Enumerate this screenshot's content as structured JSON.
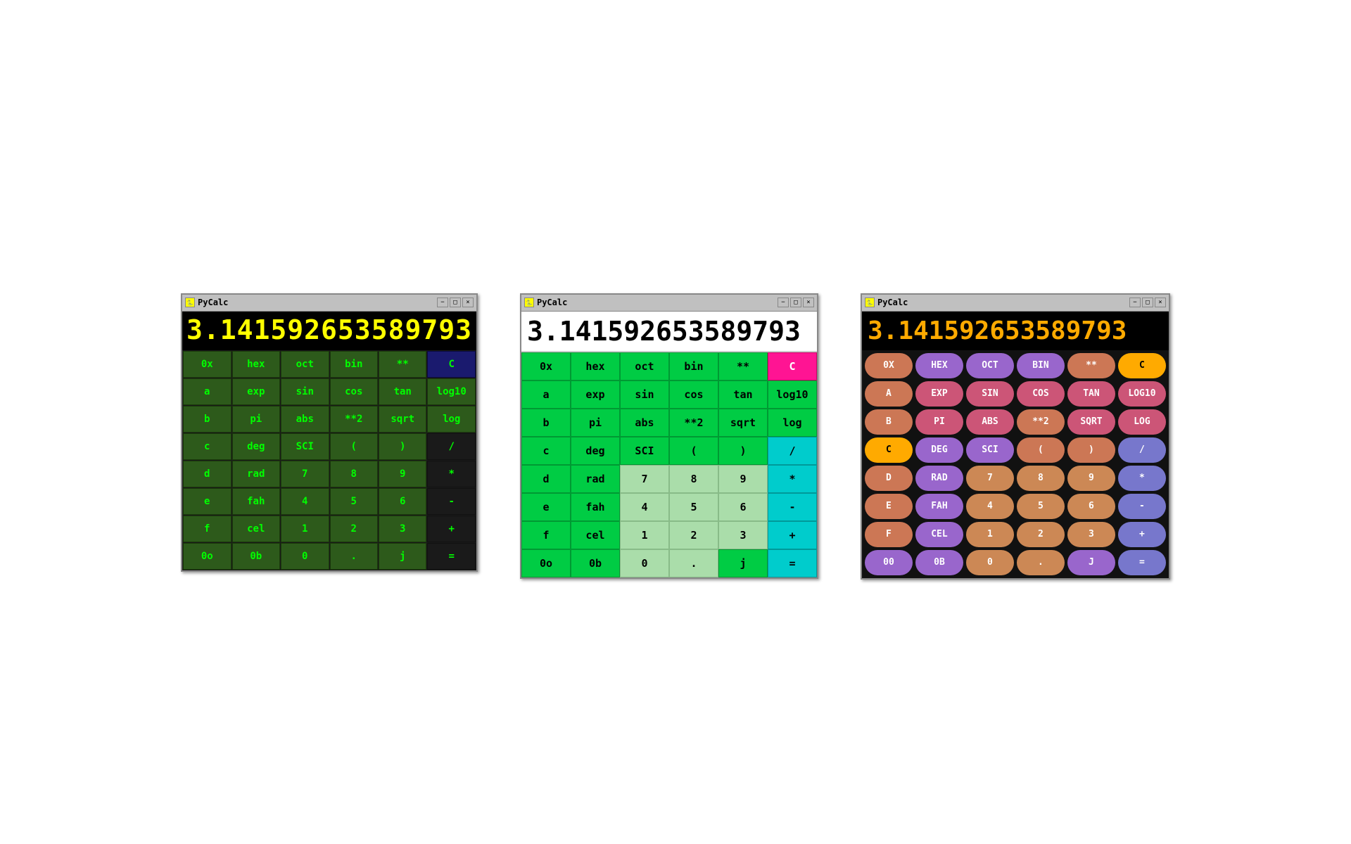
{
  "display_value": "3.141592653589793",
  "title": "PyCalc",
  "title_icon": "🐍",
  "window_controls": [
    "−",
    "□",
    "×"
  ],
  "calc1": {
    "rows": [
      [
        "0x",
        "hex",
        "oct",
        "bin",
        "**",
        "C"
      ],
      [
        "a",
        "exp",
        "sin",
        "cos",
        "tan",
        "log10"
      ],
      [
        "b",
        "pi",
        "abs",
        "**2",
        "sqrt",
        "log"
      ],
      [
        "c",
        "deg",
        "SCI",
        "(",
        ")",
        "/"
      ],
      [
        "d",
        "rad",
        "7",
        "8",
        "9",
        "*"
      ],
      [
        "e",
        "fah",
        "4",
        "5",
        "6",
        "-"
      ],
      [
        "f",
        "cel",
        "1",
        "2",
        "3",
        "+"
      ],
      [
        "0o",
        "0b",
        "0",
        ".",
        "j",
        "="
      ]
    ]
  },
  "calc2": {
    "rows": [
      [
        "0x",
        "hex",
        "oct",
        "bin",
        "**",
        "C"
      ],
      [
        "a",
        "exp",
        "sin",
        "cos",
        "tan",
        "log10"
      ],
      [
        "b",
        "pi",
        "abs",
        "**2",
        "sqrt",
        "log"
      ],
      [
        "c",
        "deg",
        "SCI",
        "(",
        ")",
        "/"
      ],
      [
        "d",
        "rad",
        "7",
        "8",
        "9",
        "*"
      ],
      [
        "e",
        "fah",
        "4",
        "5",
        "6",
        "-"
      ],
      [
        "f",
        "cel",
        "1",
        "2",
        "3",
        "+"
      ],
      [
        "0o",
        "0b",
        "0",
        ".",
        "j",
        "="
      ]
    ]
  },
  "calc3": {
    "rows": [
      [
        "0X",
        "HEX",
        "OCT",
        "BIN",
        "**",
        "C"
      ],
      [
        "A",
        "EXP",
        "SIN",
        "COS",
        "TAN",
        "LOG10"
      ],
      [
        "B",
        "PI",
        "ABS",
        "**2",
        "SQRT",
        "LOG"
      ],
      [
        "C",
        "DEG",
        "SCI",
        "(",
        ")",
        "/"
      ],
      [
        "D",
        "RAD",
        "7",
        "8",
        "9",
        "*"
      ],
      [
        "E",
        "FAH",
        "4",
        "5",
        "6",
        "-"
      ],
      [
        "F",
        "CEL",
        "1",
        "2",
        "3",
        "+"
      ],
      [
        "00",
        "0B",
        "0",
        ".",
        "J",
        "="
      ]
    ]
  }
}
